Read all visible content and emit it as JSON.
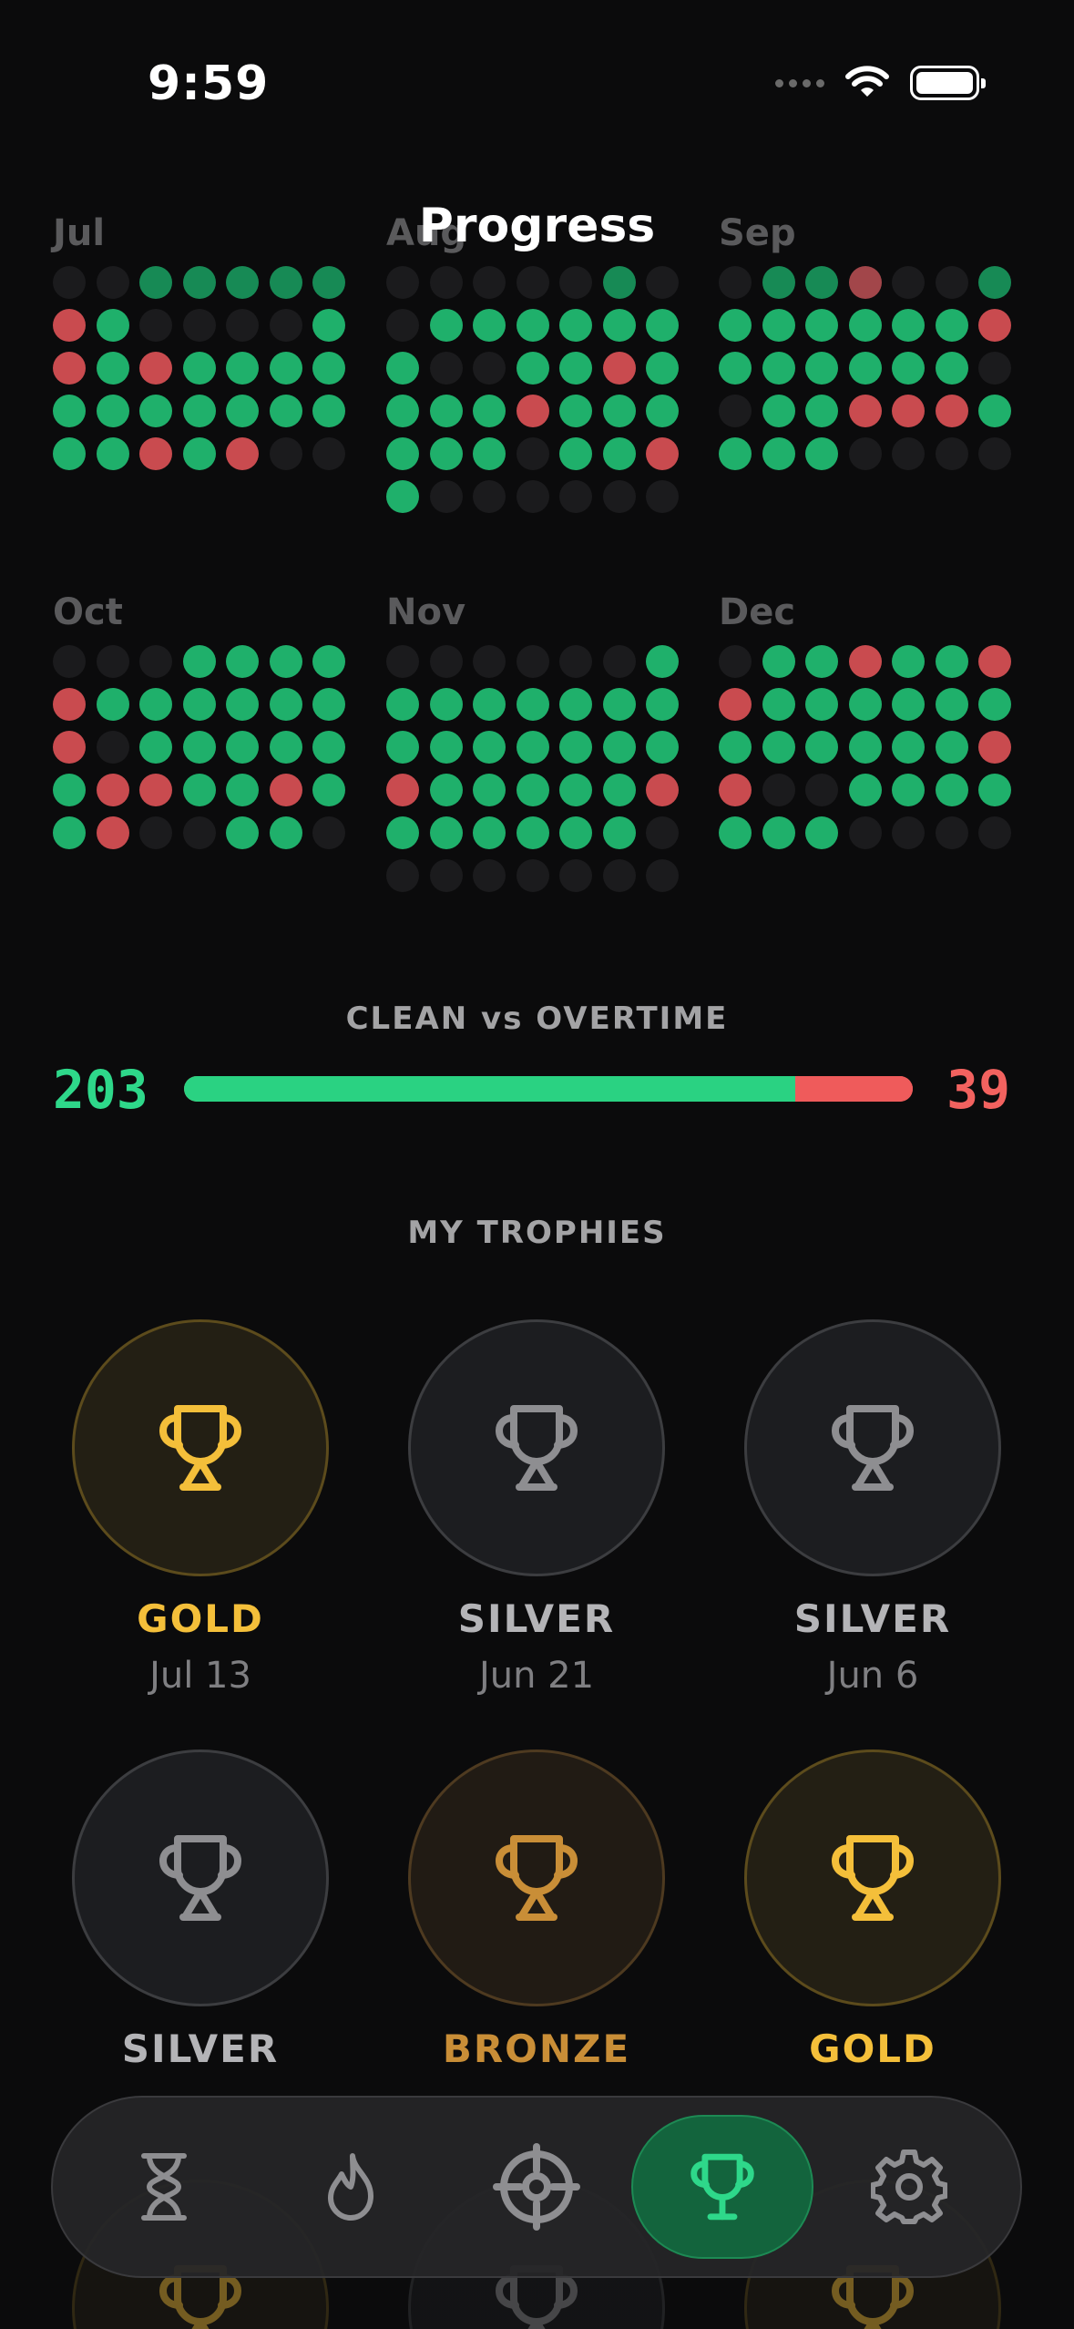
{
  "status_bar": {
    "time": "9:59"
  },
  "header": {
    "title": "Progress"
  },
  "months": [
    {
      "label": "Jul",
      "rows": [
        "..GGGGG",
        "RG....G",
        "RGRGGGG",
        "GGGGGGG",
        "GGRGR.."
      ]
    },
    {
      "label": "Aug",
      "rows": [
        ".....G.",
        ".GGGGGG",
        "G..GGRG",
        "GGGRGGG",
        "GGG.GGR",
        "G......"
      ]
    },
    {
      "label": "Sep",
      "rows": [
        ".GGR..G",
        "GGGGGGR",
        "GGGGGG.",
        ".GGRRRG",
        "GGG...."
      ]
    },
    {
      "label": "Oct",
      "rows": [
        "...GGGG",
        "RGGGGGG",
        "R.GGGGG",
        "GRRGGRG",
        "GR..GG."
      ]
    },
    {
      "label": "Nov",
      "rows": [
        "......G",
        "GGGGGGG",
        "GGGGGGG",
        "RGGGGGR",
        "GGGGGG.",
        "......."
      ]
    },
    {
      "label": "Dec",
      "rows": [
        ".GGRGGR",
        "RGGGGGG",
        "GGGGGGR",
        "R..GGGG",
        "GGG...."
      ]
    }
  ],
  "clean_vs_overtime": {
    "heading": "CLEAN vs OVERTIME",
    "clean": "203",
    "overtime": "39",
    "clean_fraction": 0.8388
  },
  "trophies": {
    "heading": "MY TROPHIES",
    "items": [
      {
        "tier": "gold",
        "label": "GOLD",
        "date": "Jul 13"
      },
      {
        "tier": "silver",
        "label": "SILVER",
        "date": "Jun 21"
      },
      {
        "tier": "silver",
        "label": "SILVER",
        "date": "Jun 6"
      },
      {
        "tier": "silver",
        "label": "SILVER",
        "date": ""
      },
      {
        "tier": "bronze",
        "label": "BRONZE",
        "date": ""
      },
      {
        "tier": "gold",
        "label": "GOLD",
        "date": ""
      }
    ]
  },
  "tabbar": {
    "tabs": [
      {
        "icon": "hourglass-icon",
        "active": false
      },
      {
        "icon": "flame-icon",
        "active": false
      },
      {
        "icon": "target-icon",
        "active": false
      },
      {
        "icon": "trophy-icon",
        "active": true
      },
      {
        "icon": "gear-icon",
        "active": false
      }
    ]
  },
  "colors": {
    "clean": "#2ad282",
    "overtime": "#ef5b5b",
    "gold": "#f4bf3a",
    "silver": "#b4b4b7",
    "bronze": "#c98e37",
    "accent": "#1d8a54"
  }
}
